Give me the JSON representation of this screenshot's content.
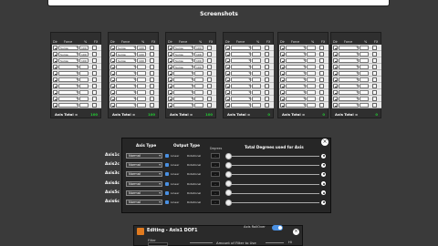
{
  "page": {
    "title": "Screenshots"
  },
  "columns": {
    "dir": "Dir",
    "force": "Force",
    "pct": "%",
    "fx": "FX"
  },
  "axes": [
    {
      "name": "Front Right",
      "total_label": "Axis Total =",
      "total": "100",
      "rows": [
        {
          "force": "Surge",
          "pct": "100"
        },
        {
          "force": "Surge",
          "pct": "100"
        },
        {
          "force": "Surge",
          "pct": "100"
        },
        {
          "force": "",
          "pct": ""
        },
        {
          "force": "",
          "pct": ""
        },
        {
          "force": "",
          "pct": ""
        },
        {
          "force": "",
          "pct": ""
        },
        {
          "force": "",
          "pct": ""
        },
        {
          "force": "",
          "pct": ""
        },
        {
          "force": "",
          "pct": ""
        }
      ]
    },
    {
      "name": "Axis2b",
      "total_label": "Axis Total =",
      "total": "100",
      "rows": [
        {
          "force": "Surge",
          "pct": "100"
        },
        {
          "force": "Surge",
          "pct": "100"
        },
        {
          "force": "Surge",
          "pct": "100"
        },
        {
          "force": "",
          "pct": ""
        },
        {
          "force": "",
          "pct": ""
        },
        {
          "force": "",
          "pct": ""
        },
        {
          "force": "",
          "pct": ""
        },
        {
          "force": "",
          "pct": ""
        },
        {
          "force": "",
          "pct": ""
        },
        {
          "force": "",
          "pct": ""
        }
      ]
    },
    {
      "name": "Axis3b",
      "total_label": "Axis Total =",
      "total": "100",
      "rows": [
        {
          "force": "Surge",
          "pct": "100"
        },
        {
          "force": "Surge",
          "pct": "100"
        },
        {
          "force": "Surge",
          "pct": "100"
        },
        {
          "force": "Surge",
          "pct": "100"
        },
        {
          "force": "",
          "pct": ""
        },
        {
          "force": "",
          "pct": ""
        },
        {
          "force": "",
          "pct": ""
        },
        {
          "force": "",
          "pct": ""
        },
        {
          "force": "",
          "pct": ""
        },
        {
          "force": "",
          "pct": ""
        }
      ]
    },
    {
      "name": "Axis4b",
      "total_label": "Axis Total =",
      "total": "0",
      "rows": [
        {
          "force": "",
          "pct": ""
        },
        {
          "force": "",
          "pct": ""
        },
        {
          "force": "",
          "pct": ""
        },
        {
          "force": "",
          "pct": ""
        },
        {
          "force": "",
          "pct": ""
        },
        {
          "force": "",
          "pct": ""
        },
        {
          "force": "",
          "pct": ""
        },
        {
          "force": "",
          "pct": ""
        },
        {
          "force": "",
          "pct": ""
        },
        {
          "force": "",
          "pct": ""
        }
      ]
    },
    {
      "name": "Axis5b",
      "total_label": "Axis Total =",
      "total": "0",
      "rows": [
        {
          "force": "",
          "pct": ""
        },
        {
          "force": "",
          "pct": ""
        },
        {
          "force": "",
          "pct": ""
        },
        {
          "force": "",
          "pct": ""
        },
        {
          "force": "",
          "pct": ""
        },
        {
          "force": "",
          "pct": ""
        },
        {
          "force": "",
          "pct": ""
        },
        {
          "force": "",
          "pct": ""
        },
        {
          "force": "",
          "pct": ""
        },
        {
          "force": "",
          "pct": ""
        }
      ]
    },
    {
      "name": "Axis6b",
      "total_label": "Axis Total =",
      "total": "0",
      "rows": [
        {
          "force": "",
          "pct": ""
        },
        {
          "force": "",
          "pct": ""
        },
        {
          "force": "",
          "pct": ""
        },
        {
          "force": "",
          "pct": ""
        },
        {
          "force": "",
          "pct": ""
        },
        {
          "force": "",
          "pct": ""
        },
        {
          "force": "",
          "pct": ""
        },
        {
          "force": "",
          "pct": ""
        },
        {
          "force": "",
          "pct": ""
        },
        {
          "force": "",
          "pct": ""
        }
      ]
    }
  ],
  "dialog": {
    "hdr_axis_type": "Axis Type",
    "hdr_output_type": "Output Type",
    "hdr_degrees": "Degrees",
    "hdr_total": "Total Degrees used for Axis",
    "close": "×",
    "rows": [
      {
        "label": "Axis1c",
        "type": "Normal",
        "o1": "Linear",
        "o2": "Rotational",
        "deg": "-"
      },
      {
        "label": "Axis2c",
        "type": "Normal",
        "o1": "Linear",
        "o2": "Rotational",
        "deg": "-"
      },
      {
        "label": "Axis3c",
        "type": "Normal",
        "o1": "Linear",
        "o2": "Rotational",
        "deg": "-"
      },
      {
        "label": "Axis4c",
        "type": "Normal",
        "o1": "Linear",
        "o2": "Rotational",
        "deg": "-"
      },
      {
        "label": "Axis5c",
        "type": "Normal",
        "o1": "Linear",
        "o2": "Rotational",
        "deg": "-"
      },
      {
        "label": "Axis6c",
        "type": "Normal",
        "o1": "Linear",
        "o2": "Rotational",
        "deg": "-"
      }
    ]
  },
  "edit": {
    "title": "Editing - Axis1 DOF1",
    "toggle_label": "Axis RollOver",
    "filter_label": "Filter",
    "amount_label": "Amount of Filter to Use",
    "high_label": "Hi",
    "close": "×"
  }
}
